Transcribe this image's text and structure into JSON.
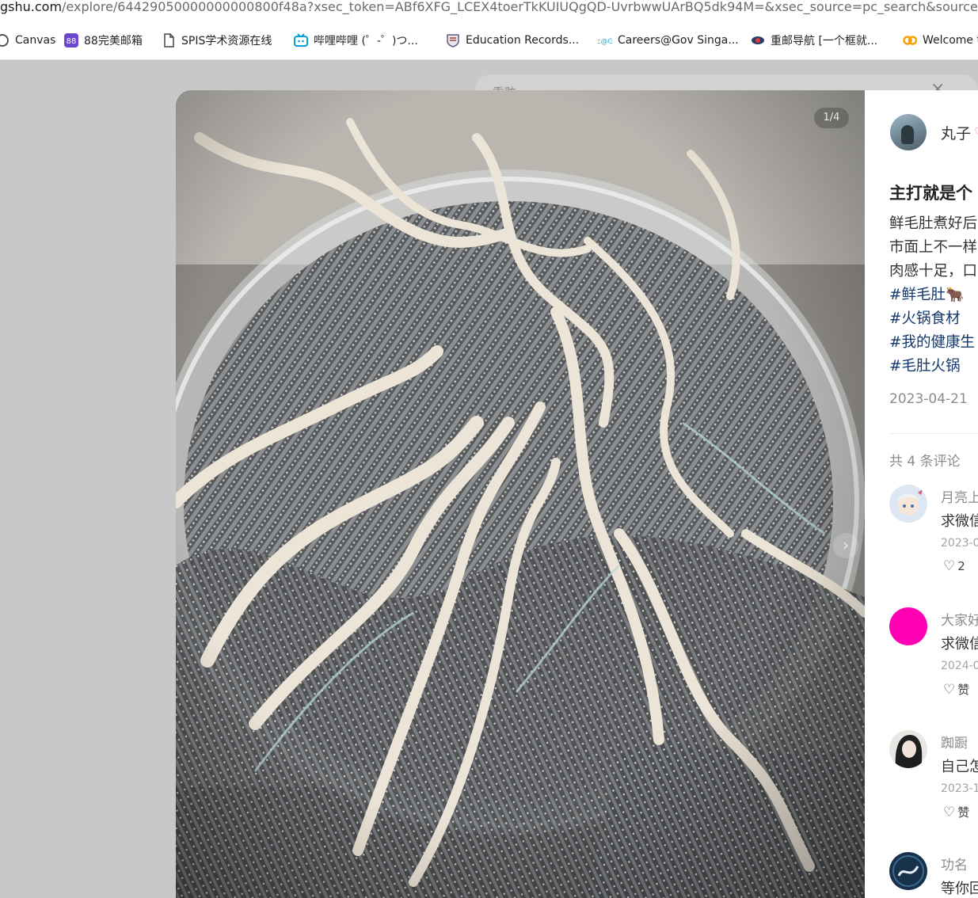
{
  "browser": {
    "url_host": "gshu.com",
    "url_rest": "/explore/64429050000000000800f48a?xsec_token=ABf6XFG_LCEX4toerTkKUIUQgQD-UvrbwwUArBQ5dk94M=&xsec_source=pc_search&source=web_s",
    "bookmarks": [
      {
        "label": "Canvas",
        "icon": "canvas-icon"
      },
      {
        "label": "88完美邮箱",
        "icon": "mail88-icon"
      },
      {
        "label": "SPIS学术资源在线",
        "icon": "document-icon"
      },
      {
        "label": "哔哩哔哩 (゜-゜)つ...",
        "icon": "bilibili-icon"
      },
      {
        "label": "Education Records...",
        "icon": "university-shield-icon"
      },
      {
        "label": "Careers@Gov Singa...",
        "icon": "careers-gov-icon"
      },
      {
        "label": "重邮导航 [一个框就...",
        "icon": "cqupt-icon"
      },
      {
        "label": "Welcome t",
        "icon": "welcome-icon"
      }
    ]
  },
  "overlay": {
    "search_ghost": "重防",
    "close_glyph": "×"
  },
  "photo": {
    "counter": "1/4",
    "next_glyph": "›"
  },
  "note": {
    "author": "丸子",
    "author_badge": "♡",
    "title": "主打就是个",
    "description_lines": [
      "鲜毛肚煮好后",
      "市面上不一样",
      "肉感十足，口"
    ],
    "tags": [
      "#鲜毛肚🐂",
      "#火锅食材",
      "#我的健康生",
      "#毛肚火锅"
    ],
    "date": "2023-04-21",
    "comment_count": "共 4 条评论"
  },
  "comments": [
    {
      "name": "月亮上",
      "text": "求微信",
      "date": "2023-0",
      "like_icon": "heart-outline-icon",
      "likes": "2",
      "avatar_color": "#dde7f3"
    },
    {
      "name": "大家好",
      "text": "求微信",
      "date": "2024-0",
      "like_icon": "heart-outline-icon",
      "likes": "赞",
      "avatar_color": "#ff00b2"
    },
    {
      "name": "踟蹰",
      "text": "自己怎",
      "date": "2023-1",
      "like_icon": "heart-outline-icon",
      "likes": "赞",
      "avatar_color": "#2a2a2a"
    },
    {
      "name": "功名",
      "text": "等你回",
      "date": "",
      "like_icon": "heart-outline-icon",
      "likes": "",
      "avatar_color": "#17324a"
    }
  ],
  "colors": {
    "tag_link": "#13386c",
    "muted_text": "#8c8c8c",
    "overlay_bg": "#c8c8c8"
  }
}
